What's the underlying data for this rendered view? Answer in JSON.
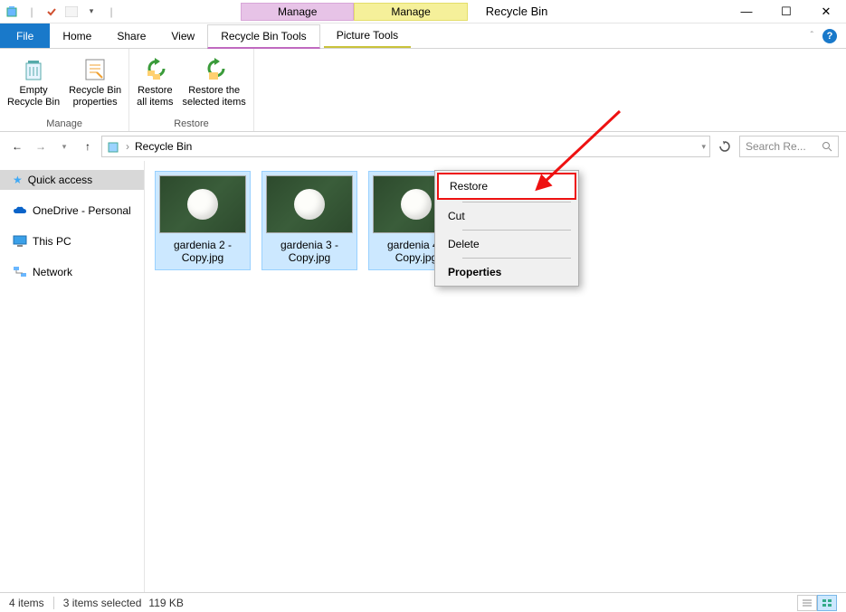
{
  "titlebar": {
    "manage1": "Manage",
    "manage2": "Manage",
    "window_title": "Recycle Bin"
  },
  "tabs": {
    "file": "File",
    "home": "Home",
    "share": "Share",
    "view": "View",
    "rbtools": "Recycle Bin Tools",
    "ptools": "Picture Tools"
  },
  "ribbon": {
    "empty": "Empty\nRecycle Bin",
    "props": "Recycle Bin\nproperties",
    "manage_group": "Manage",
    "restore_all": "Restore\nall items",
    "restore_sel": "Restore the\nselected items",
    "restore_group": "Restore"
  },
  "address": {
    "location": "Recycle Bin",
    "search_placeholder": "Search Re..."
  },
  "nav": {
    "quick": "Quick access",
    "onedrive": "OneDrive - Personal",
    "thispc": "This PC",
    "network": "Network"
  },
  "files": [
    {
      "name": "gardenia 2 - Copy.jpg",
      "selected": true
    },
    {
      "name": "gardenia 3 - Copy.jpg",
      "selected": true
    },
    {
      "name": "gardenia 4 - Copy.jpg",
      "selected": true
    }
  ],
  "context": {
    "restore": "Restore",
    "cut": "Cut",
    "delete": "Delete",
    "properties": "Properties"
  },
  "status": {
    "count": "4 items",
    "sel": "3 items selected",
    "size": "119 KB"
  }
}
